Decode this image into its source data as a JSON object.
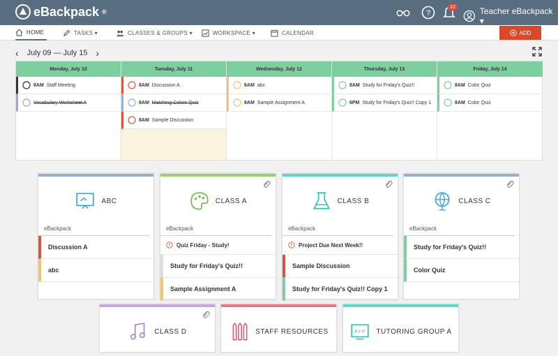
{
  "app": {
    "name": "eBackpack",
    "reg": "®"
  },
  "topbar": {
    "notification_count": "10",
    "user_label": "Teacher eBackpack ▾"
  },
  "nav": [
    {
      "label": "HOME",
      "icon": "home-icon",
      "active": true
    },
    {
      "label": "TASKS ▾",
      "icon": "pencil-icon"
    },
    {
      "label": "CLASSES & GROUPS ▾",
      "icon": "group-icon"
    },
    {
      "label": "WORKSPACE ▾",
      "icon": "workspace-icon"
    },
    {
      "label": "CALENDAR",
      "icon": "calendar-icon"
    }
  ],
  "add_label": "ADD",
  "week": {
    "range": "July 09 — July 15",
    "prev": "‹",
    "next": "›"
  },
  "calendar": [
    {
      "day": "Monday, July 10",
      "events": [
        {
          "time": "8AM",
          "title": "Staff Meeting",
          "color": "#333333",
          "done": false
        },
        {
          "time": "",
          "title": "Vocabulary Worksheet A",
          "color": "#b59bd6",
          "done": true
        }
      ]
    },
    {
      "day": "Tuesday, July 11",
      "events": [
        {
          "time": "8AM",
          "title": "Discussion A",
          "color": "#d9553b",
          "done": false
        },
        {
          "time": "8AM",
          "title": "Matching Colors Quiz",
          "color": "#8fb1d6",
          "done": true
        },
        {
          "time": "8AM",
          "title": "Sample Discussion",
          "color": "#d9553b",
          "done": false
        }
      ]
    },
    {
      "day": "Wednesday, July 12",
      "events": [
        {
          "time": "8AM",
          "title": "abc",
          "color": "#f2c46d",
          "done": false
        },
        {
          "time": "8AM",
          "title": "Sample Assignment A",
          "color": "#f2c46d",
          "done": false
        }
      ]
    },
    {
      "day": "Thursday, July 13",
      "events": [
        {
          "time": "8AM",
          "title": "Study for Friday's Quiz!!",
          "color": "#7ecfa0",
          "done": false
        },
        {
          "time": "6PM",
          "title": "Study for Friday's Quiz!! Copy 1",
          "color": "#7ecfa0",
          "done": false
        }
      ]
    },
    {
      "day": "Friday, July 14",
      "events": [
        {
          "time": "8AM",
          "title": "Color Quiz",
          "color": "#7ecfa0",
          "done": false
        },
        {
          "time": "8AM",
          "title": "Color Quiz",
          "color": "#7ecfa0",
          "done": false
        }
      ]
    }
  ],
  "cards": [
    {
      "name": "ABC",
      "strip": "#8fb1d6",
      "owner": "eBackpack",
      "icon": "whiteboard-icon",
      "clip": false,
      "alert": "",
      "items": [
        {
          "label": "Discussion A",
          "color": "#d9553b"
        },
        {
          "label": "abc",
          "color": "#f2c46d"
        }
      ]
    },
    {
      "name": "CLASS A",
      "strip": "#9ccd6e",
      "owner": "eBackpack",
      "icon": "palette-icon",
      "clip": true,
      "alert": "Quiz Friday - Study!",
      "items": [
        {
          "label": "Study for Friday's Quiz!!",
          "color": "#dddddd"
        },
        {
          "label": "Sample Assignment A",
          "color": "#f2c46d"
        }
      ]
    },
    {
      "name": "CLASS B",
      "strip": "#5ed8c6",
      "owner": "eBackpack",
      "icon": "beaker-icon",
      "clip": true,
      "alert": "Project Due Next Week!!",
      "items": [
        {
          "label": "Sample Discussion",
          "color": "#d9553b"
        },
        {
          "label": "Study for Friday's Quiz!! Copy 1",
          "color": "#7ecfa0"
        }
      ]
    },
    {
      "name": "CLASS C",
      "strip": "#8fb1d6",
      "owner": "eBackpack",
      "icon": "globe-icon",
      "clip": true,
      "alert": "",
      "items": [
        {
          "label": "Study for Friday's Quiz!!",
          "color": "#7ecfa0"
        },
        {
          "label": "Color Quiz",
          "color": "#7ecfa0"
        }
      ]
    },
    {
      "name": "CLASS D",
      "strip": "#c2a8dc",
      "owner": "",
      "icon": "music-icon",
      "clip": true,
      "alert": "",
      "items": []
    },
    {
      "name": "STAFF RESOURCES",
      "strip": "#e07a8a",
      "owner": "",
      "icon": "pencils-icon",
      "clip": false,
      "alert": "",
      "items": []
    },
    {
      "name": "TUTORING GROUP A",
      "strip": "#5ed8c6",
      "owner": "",
      "icon": "math-icon",
      "clip": false,
      "alert": "",
      "items": []
    }
  ]
}
